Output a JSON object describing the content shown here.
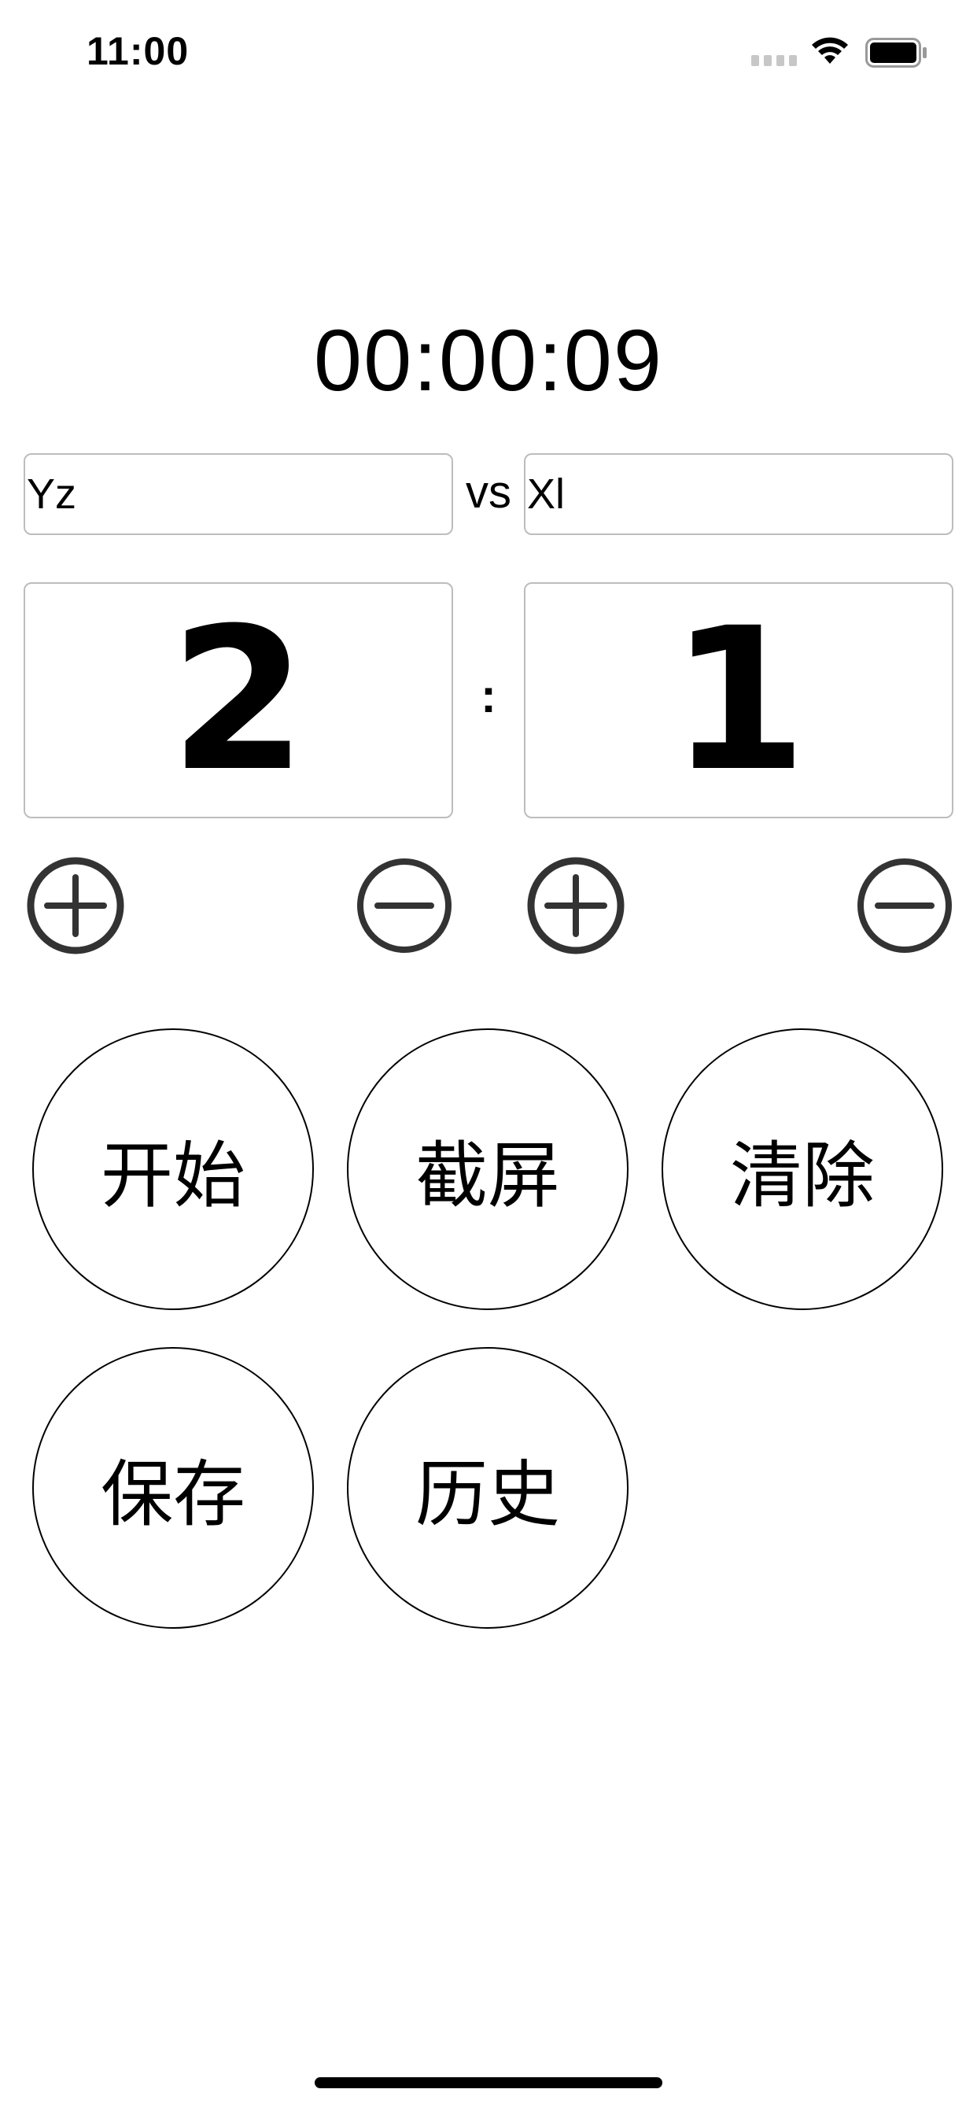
{
  "status_bar": {
    "time": "11:00",
    "icons": [
      "signal-icon",
      "wifi-icon",
      "battery-icon"
    ]
  },
  "timer": {
    "display": "00:00:09"
  },
  "teams": {
    "a": {
      "name": "Yz",
      "score": "2"
    },
    "b": {
      "name": "Xl",
      "score": "1"
    },
    "vs_label": "vs",
    "score_separator": ":"
  },
  "score_controls": {
    "icons": [
      "plus-circle-icon",
      "minus-circle-icon"
    ],
    "icon_color": "#333333"
  },
  "actions": {
    "start": "开始",
    "screenshot": "截屏",
    "clear": "清除",
    "save": "保存",
    "history": "历史"
  },
  "colors": {
    "background": "#ffffff",
    "text": "#000000",
    "border": "#bdbdbd"
  }
}
